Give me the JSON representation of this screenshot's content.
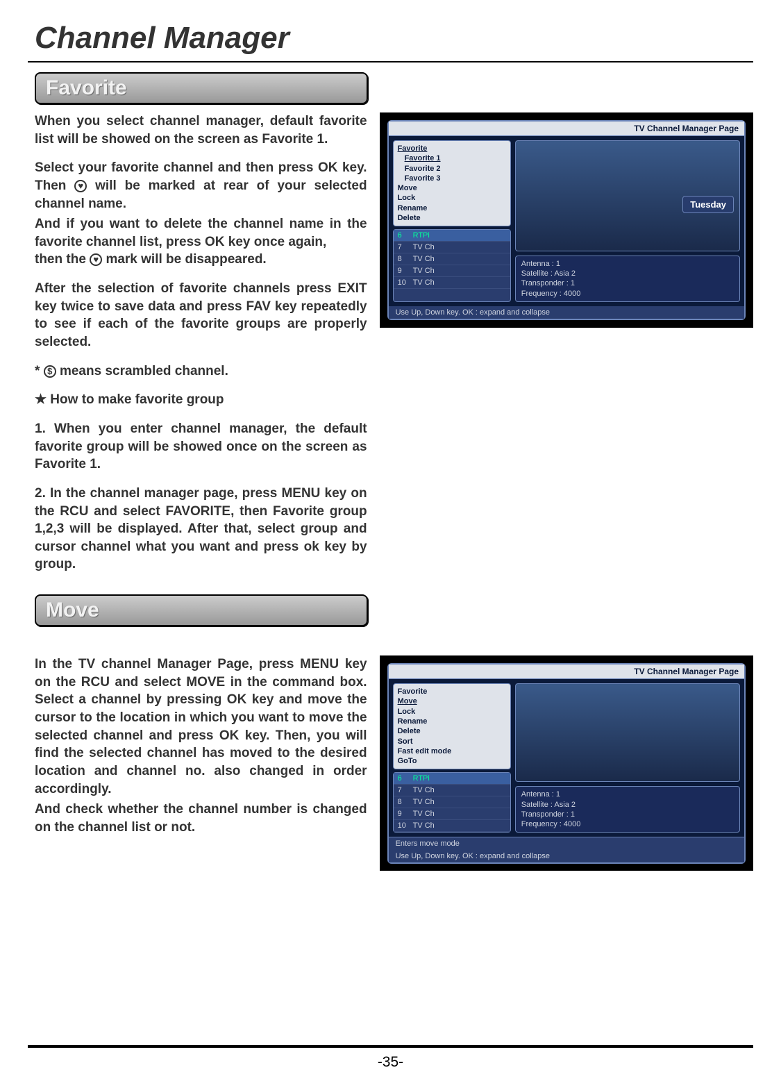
{
  "page_title": "Channel Manager",
  "page_number": "-35-",
  "sections": {
    "favorite": {
      "title": "Favorite",
      "p1": "When  you  select  channel  manager,  default favorite  list  will  be  showed  on  the  screen  as Favorite 1.",
      "p2_a": " Select your favorite channel and then press ",
      "p2_ok1": "OK",
      "p2_b": " key.  Then ",
      "p2_c": "  will  be  marked  at  rear  of  your selected channel name.",
      "p3_a": "And if you want to delete the channel name in the favorite channel list, press ",
      "p3_ok2": "OK",
      "p3_b": " key once again,",
      "p3_c": "then the ",
      "p3_d": " mark will be disappeared.",
      "p4": "After the selection of favorite channels press EXIT key  twice  to  save  data  and  press  FAV  key repeatedly to see if each of the favorite groups are properly selected.",
      "p5_prefix": " * ",
      "p5": " means scrambled channel.",
      "howto_title": "★  How to  make favorite group",
      "step1": "1. When you enter channel manager, the default favorite group will be showed once on the screen as Favorite 1.",
      "step2": "2. In the channel manager page, press MENU key on the RCU and select FAVORITE, then Favorite group 1,2,3 will be displayed. After that, select group and cursor channel what you want and press ok key by group."
    },
    "move": {
      "title": "Move",
      "p1": "In the TV channel Manager Page, press MENU key on the RCU and select MOVE in the command box. Select a channel by pressing OK key and move the cursor to the location in which you want to move the selected channel and press OK key. Then, you will find the selected channel has moved to the desired location and channel no. also changed in order accordingly.",
      "p2": "And check whether the channel number is changed on the channel list or not."
    }
  },
  "screenshot1": {
    "title": "TV Channel Manager Page",
    "menu": [
      "Favorite",
      "Favorite 1",
      "Favorite 2",
      "Favorite 3",
      "Move",
      "Lock",
      "Rename",
      "Delete"
    ],
    "channels": [
      {
        "num": "6",
        "name": "RTPi"
      },
      {
        "num": "7",
        "name": "TV Ch"
      },
      {
        "num": "8",
        "name": "TV Ch"
      },
      {
        "num": "9",
        "name": "TV Ch"
      },
      {
        "num": "10",
        "name": "TV Ch"
      }
    ],
    "preview_caption": "Tuesday",
    "info": {
      "antenna": "Antenna : 1",
      "satellite": "Satellite : Asia 2",
      "transponder": "Transponder : 1",
      "frequency": "Frequency : 4000"
    },
    "hint": "Use Up, Down key. OK : expand and collapse"
  },
  "screenshot2": {
    "title": "TV Channel Manager Page",
    "menu": [
      "Favorite",
      "Move",
      "Lock",
      "Rename",
      "Delete",
      "Sort",
      "Fast edit mode",
      "GoTo"
    ],
    "channels": [
      {
        "num": "6",
        "name": "RTPi"
      },
      {
        "num": "7",
        "name": "TV Ch"
      },
      {
        "num": "8",
        "name": "TV Ch"
      },
      {
        "num": "9",
        "name": "TV Ch"
      },
      {
        "num": "10",
        "name": "TV Ch"
      }
    ],
    "info": {
      "antenna": "Antenna : 1",
      "satellite": "Satellite : Asia 2",
      "transponder": "Transponder : 1",
      "frequency": "Frequency : 4000"
    },
    "hint_top": "Enters move mode",
    "hint": "Use Up, Down key. OK : expand and collapse"
  }
}
